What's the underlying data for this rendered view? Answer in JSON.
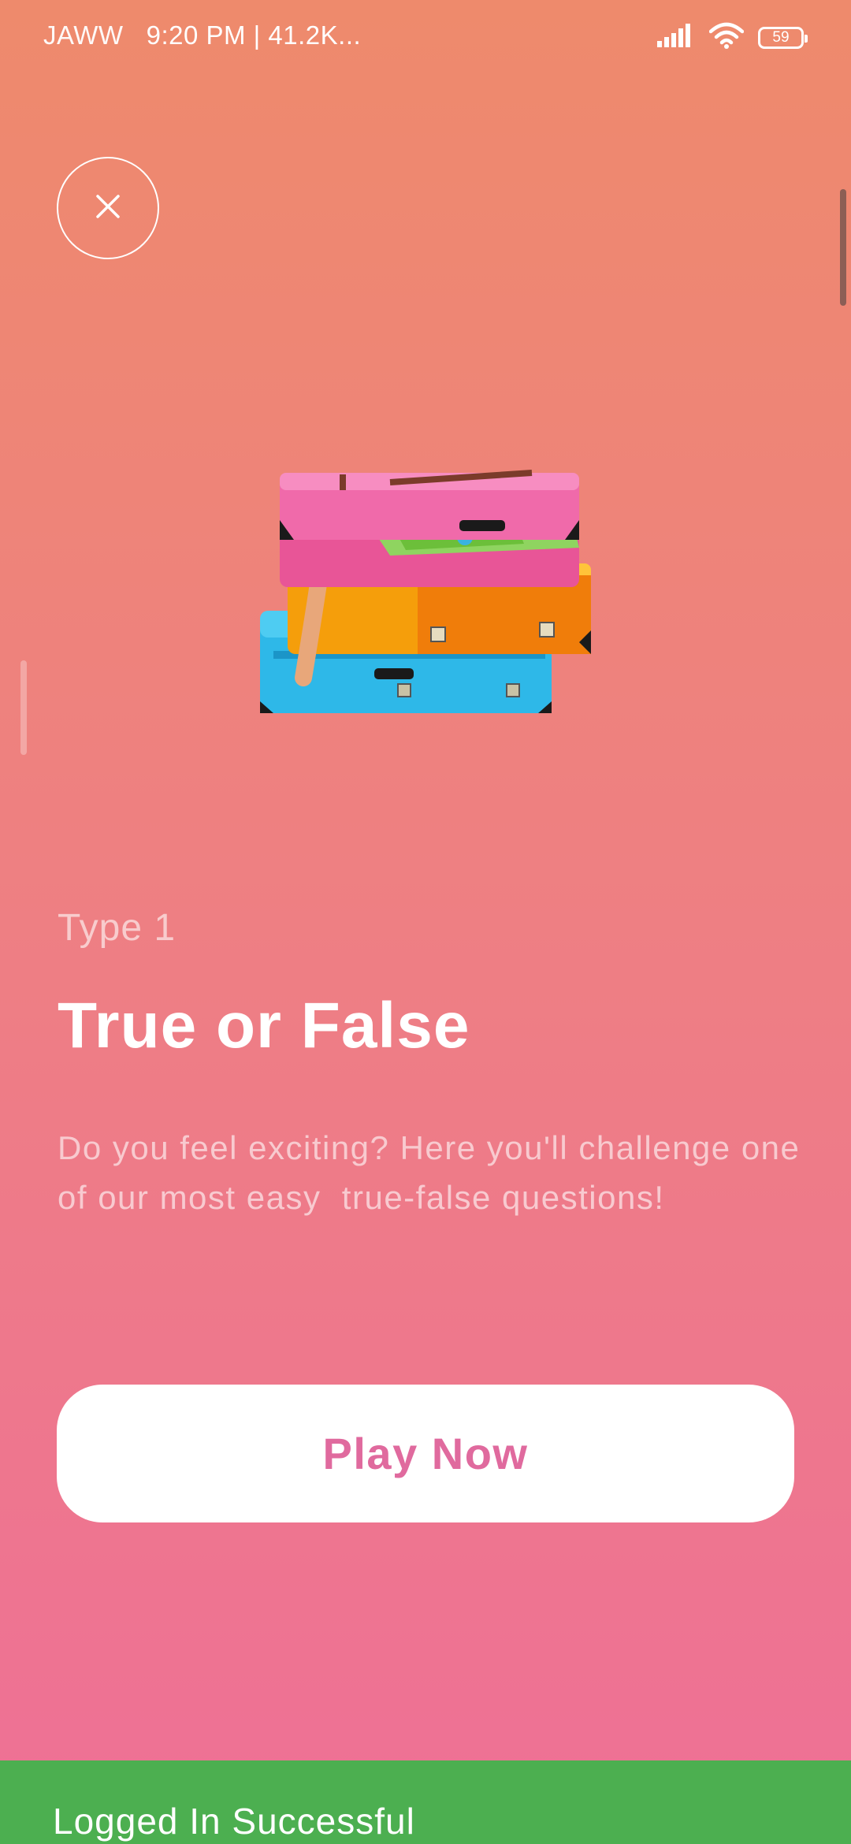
{
  "status_bar": {
    "carrier": "JAWW",
    "time_info": "9:20 PM | 41.2K...",
    "battery_level": "59",
    "icons": [
      "signal-icon",
      "wifi-icon",
      "battery-icon"
    ]
  },
  "header": {
    "close_icon": "close-icon"
  },
  "quiz": {
    "type_label": "Type 1",
    "title": "True or False",
    "description": "Do you feel exciting? Here you'll challenge one of our most easy  true-false questions!",
    "illustration": "stacked-suitcases-illustration"
  },
  "actions": {
    "play_label": "Play Now"
  },
  "snackbar": {
    "message": "Logged In Successful"
  },
  "colors": {
    "gradient_top": "#EE8A6C",
    "gradient_bottom": "#EE7096",
    "button_text": "#E06A9E",
    "snackbar_bg": "#4CAF50"
  }
}
